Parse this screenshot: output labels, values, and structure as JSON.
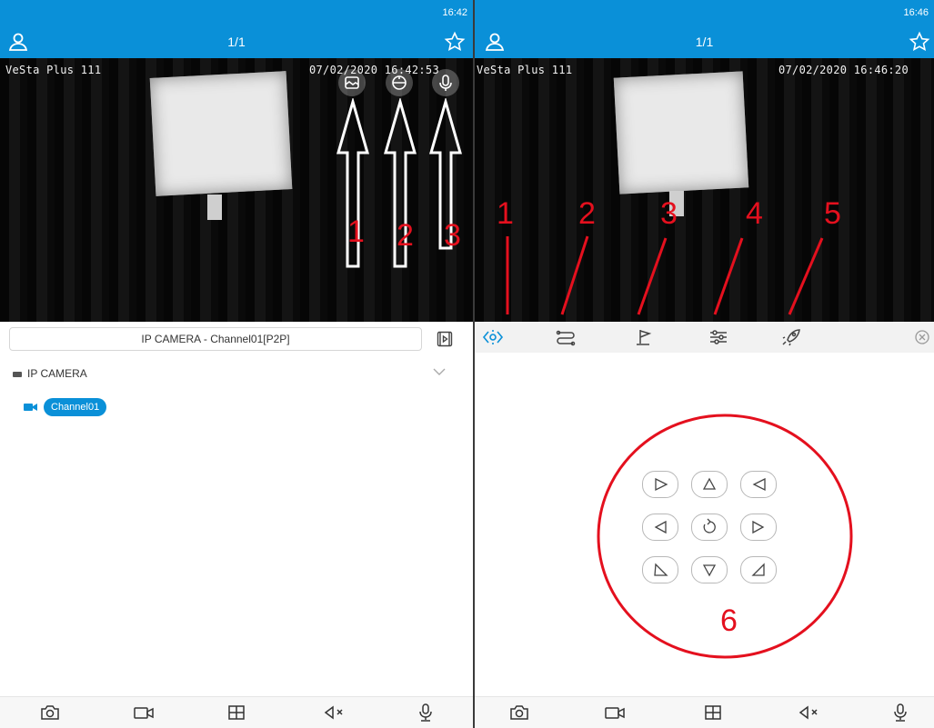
{
  "left": {
    "status_time": "16:42",
    "title": "1/1",
    "video": {
      "camera_name": "VeSta Plus 111",
      "timestamp": "07/02/2020 16:42:53"
    },
    "channel_bar": "IP CAMERA - Channel01[P2P]",
    "tree": {
      "root": "IP CAMERA",
      "channel": "Channel01"
    },
    "annotations": [
      "1",
      "2",
      "3"
    ]
  },
  "right": {
    "status_time": "16:46",
    "title": "1/1",
    "video": {
      "camera_name": "VeSta Plus 111",
      "timestamp": "07/02/2020 16:46:20"
    },
    "annotations": [
      "1",
      "2",
      "3",
      "4",
      "5",
      "6"
    ]
  },
  "icons": {
    "top": [
      "user-icon",
      "star-icon"
    ],
    "video_overlay": [
      "picture-icon",
      "ptz-dome-icon",
      "microphone-icon"
    ],
    "ptz_toolbar": [
      "direction-icon",
      "route-icon",
      "preset-flag-icon",
      "settings-sliders-icon",
      "rocket-icon",
      "close-icon"
    ],
    "ptz_pad": [
      "up-left-arrow",
      "up-arrow",
      "up-right-arrow",
      "left-arrow",
      "reset-icon",
      "right-arrow",
      "down-left-arrow",
      "down-arrow",
      "down-right-arrow"
    ],
    "bottom": [
      "camera-icon",
      "video-record-icon",
      "grid-icon",
      "mute-icon",
      "microphone-icon"
    ]
  },
  "colors": {
    "accent": "#0a90d8",
    "annotation_red": "#e4101e"
  }
}
